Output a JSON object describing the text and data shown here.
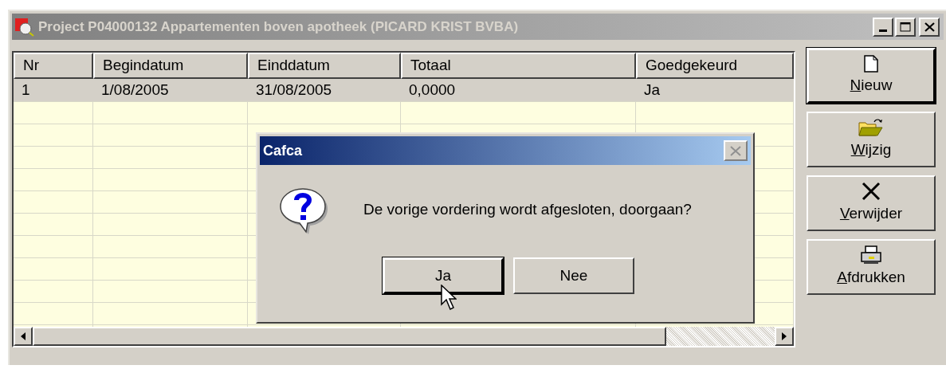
{
  "window": {
    "title": "Project P04000132 Appartementen boven apotheek (PICARD KRIST BVBA)",
    "active": false
  },
  "table": {
    "columns": [
      "Nr",
      "Begindatum",
      "Einddatum",
      "Totaal",
      "Goedgekeurd"
    ],
    "rows": [
      {
        "cells": [
          "1",
          "1/08/2005",
          "31/08/2005",
          "0,0000",
          "Ja"
        ],
        "selected": true
      }
    ]
  },
  "actions": [
    {
      "kind": "new",
      "label": "Nieuw",
      "default": true
    },
    {
      "kind": "edit",
      "label": "Wijzig",
      "default": false
    },
    {
      "kind": "delete",
      "label": "Verwijder",
      "default": false
    },
    {
      "kind": "print",
      "label": "Afdrukken",
      "default": false
    }
  ],
  "dialog": {
    "title": "Cafca",
    "active": true,
    "message": "De vorige vordering wordt afgesloten, doorgaan?",
    "buttons": [
      {
        "label": "Ja",
        "default": true
      },
      {
        "label": "Nee",
        "default": false
      }
    ]
  }
}
